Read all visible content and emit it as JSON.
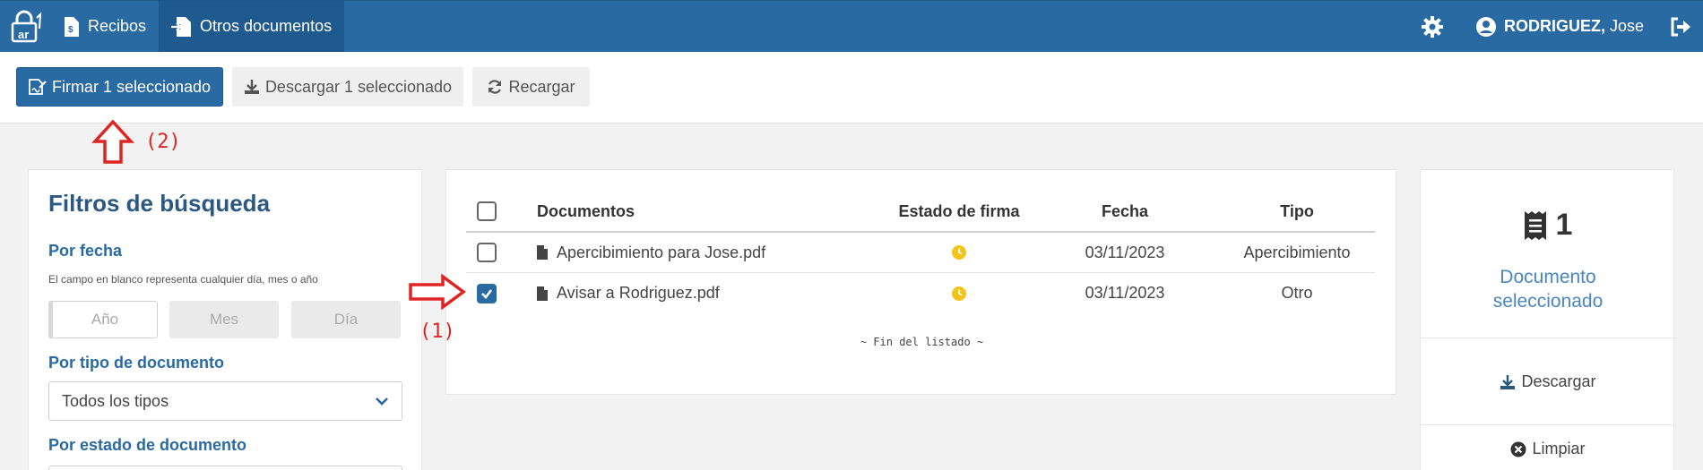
{
  "nav": {
    "items": [
      {
        "label": "Recibos",
        "icon": "receipt-file-icon"
      },
      {
        "label": "Otros documentos",
        "icon": "file-import-icon"
      }
    ],
    "user": {
      "surname": "RODRIGUEZ,",
      "name": "Jose"
    }
  },
  "toolbar": {
    "sign_label": "Firmar 1 seleccionado",
    "download_label": "Descargar 1 seleccionado",
    "reload_label": "Recargar"
  },
  "annotations": {
    "step1": "(1)",
    "step2": "(2)"
  },
  "filters": {
    "title": "Filtros de búsqueda",
    "by_date": "Por fecha",
    "date_hint": "El campo en blanco representa cualquier día, mes o año",
    "year_placeholder": "Año",
    "month_placeholder": "Mes",
    "day_placeholder": "Día",
    "by_type": "Por tipo de documento",
    "type_value": "Todos los tipos",
    "by_state": "Por estado de documento"
  },
  "table": {
    "headers": {
      "documents": "Documentos",
      "state": "Estado de firma",
      "date": "Fecha",
      "type": "Tipo"
    },
    "rows": [
      {
        "name": "Apercibimiento para Jose.pdf",
        "date": "03/11/2023",
        "type": "Apercibimiento",
        "checked": false,
        "state_icon": "pending-clock-icon"
      },
      {
        "name": "Avisar a Rodriguez.pdf",
        "date": "03/11/2023",
        "type": "Otro",
        "checked": true,
        "state_icon": "pending-clock-icon"
      }
    ],
    "end_text": "~ Fin del listado ~"
  },
  "summary": {
    "count": "1",
    "label_line1": "Documento",
    "label_line2": "seleccionado",
    "download": "Descargar",
    "clear": "Limpiar"
  },
  "colors": {
    "primary": "#2a6aa3",
    "pending": "#f2c418",
    "annotation": "#e02424"
  }
}
